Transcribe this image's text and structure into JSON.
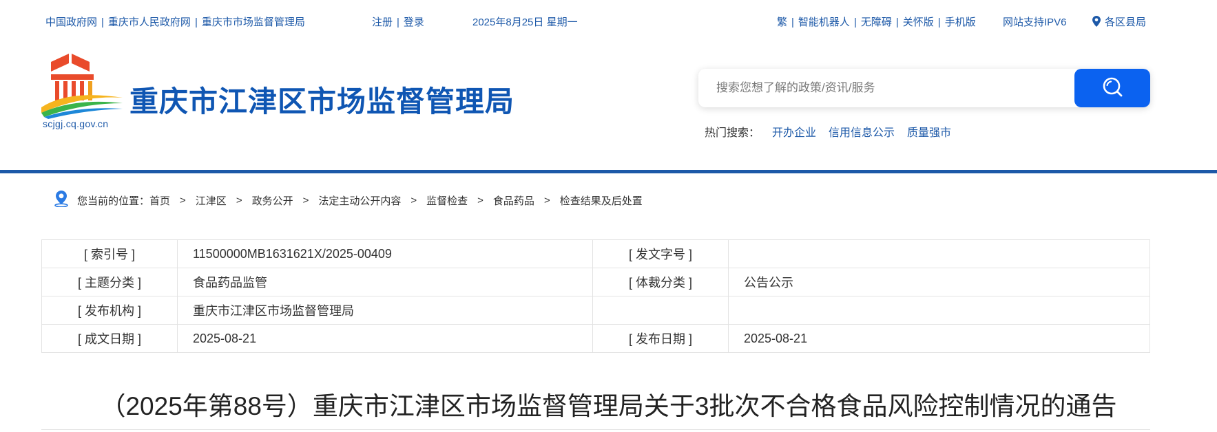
{
  "topbar": {
    "links": [
      "中国政府网",
      "重庆市人民政府网",
      "重庆市市场监督管理局"
    ],
    "separator": "|",
    "register": "注册",
    "login": "登录",
    "date": "2025年8月25日 星期一",
    "right_links": [
      "繁",
      "智能机器人",
      "无障碍",
      "关怀版",
      "手机版"
    ],
    "ipv6": "网站支持IPV6",
    "districts": "各区县局"
  },
  "header": {
    "logo_domain": "scjgj.cq.gov.cn",
    "site_title": "重庆市江津区市场监督管理局"
  },
  "search": {
    "placeholder": "搜索您想了解的政策/资讯/服务",
    "hot_label": "热门搜索：",
    "hot_terms": [
      "开办企业",
      "信用信息公示",
      "质量强市"
    ]
  },
  "breadcrumb": {
    "prefix": "您当前的位置：",
    "items": [
      "首页",
      "江津区",
      "政务公开",
      "法定主动公开内容",
      "监督检查",
      "食品药品",
      "检查结果及后处置"
    ],
    "separator": ">"
  },
  "meta_table": {
    "rows": [
      {
        "k1": "[ 索引号 ]",
        "v1": "11500000MB1631621X/2025-00409",
        "k2": "[ 发文字号 ]",
        "v2": ""
      },
      {
        "k1": "[ 主题分类 ]",
        "v1": "食品药品监管",
        "k2": "[ 体裁分类 ]",
        "v2": "公告公示"
      },
      {
        "k1": "[ 发布机构 ]",
        "v1": "重庆市江津区市场监督管理局",
        "k2": "",
        "v2": ""
      },
      {
        "k1": "[ 成文日期 ]",
        "v1": "2025-08-21",
        "k2": "[ 发布日期 ]",
        "v2": "2025-08-21"
      }
    ]
  },
  "document": {
    "title": "（2025年第88号）重庆市江津区市场监督管理局关于3批次不合格食品风险控制情况的通告"
  },
  "colors": {
    "brand_blue": "#1d59a8",
    "title_blue": "#0f56b3",
    "search_button": "#0b62f0"
  },
  "icons": [
    "location-pin-icon",
    "search-icon",
    "breadcrumb-person-pin-icon",
    "site-logo"
  ]
}
